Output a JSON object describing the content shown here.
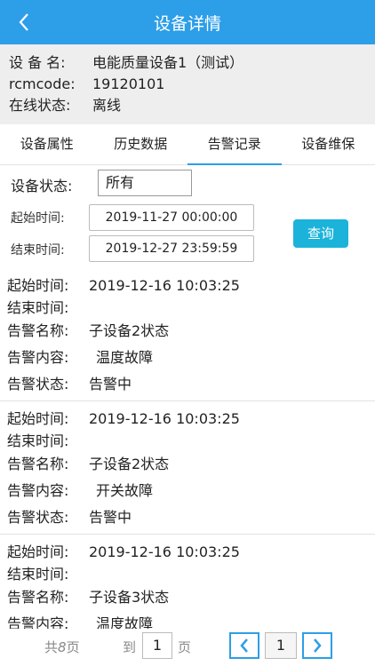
{
  "header": {
    "title": "设备详情",
    "back_icon": "chevron-left-icon",
    "background": "#2d9ee8"
  },
  "device": {
    "name_label": "设 备 名:",
    "name_value": "电能质量设备1（测试）",
    "rcm_label": "rcmcode:",
    "rcm_value": "19120101",
    "online_label": "在线状态:",
    "online_value": "离线"
  },
  "tabs": [
    {
      "label": "设备属性"
    },
    {
      "label": "历史数据"
    },
    {
      "label": "告警记录"
    },
    {
      "label": "设备维保"
    }
  ],
  "active_tab": "告警记录",
  "filters": {
    "status_label": "设备状态:",
    "status_value": "所有",
    "start_label": "起始时间:",
    "start_value": "2019-11-27 00:00:00",
    "end_label": "结束时间:",
    "end_value": "2019-12-27 23:59:59",
    "query_label": "查询",
    "query_color": "#1bb3d9"
  },
  "record_labels": {
    "start": "起始时间:",
    "end": "结束时间:",
    "name": "告警名称:",
    "content": "告警内容:",
    "status": "告警状态:"
  },
  "records": [
    {
      "start": "2019-12-16 10:03:25",
      "end": "",
      "name": "子设备2状态",
      "content": "温度故障",
      "status": "告警中"
    },
    {
      "start": "2019-12-16 10:03:25",
      "end": "",
      "name": "子设备2状态",
      "content": "开关故障",
      "status": "告警中"
    },
    {
      "start": "2019-12-16 10:03:25",
      "end": "",
      "name": "子设备3状态",
      "content": "温度故障",
      "status": ""
    }
  ],
  "status_color": "#e7a93b",
  "pager": {
    "total_prefix": "共",
    "total_pages": "8",
    "total_suffix": "页",
    "goto_prefix": "到",
    "goto_value": "1",
    "goto_suffix": "页",
    "current_page": "1"
  }
}
